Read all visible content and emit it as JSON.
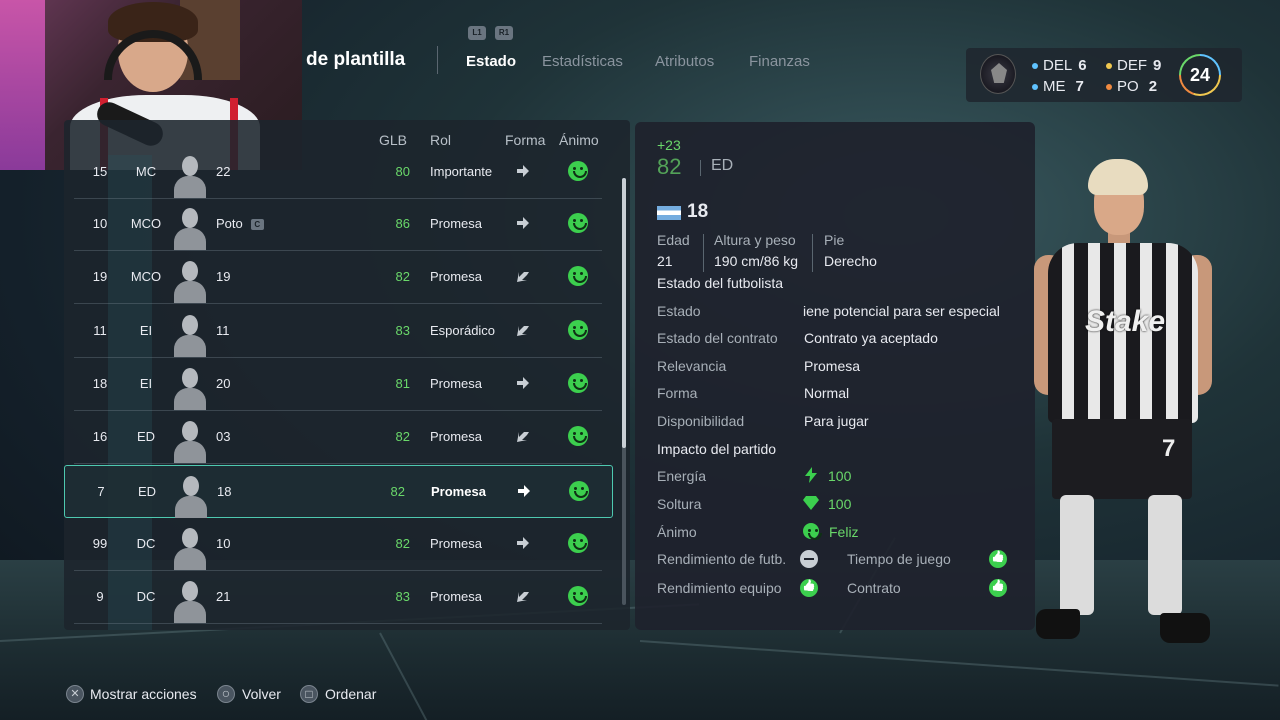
{
  "header": {
    "title": "de plantilla",
    "shoulder_left": "L1",
    "shoulder_right": "R1",
    "tabs": [
      {
        "label": "Estado",
        "active": true
      },
      {
        "label": "Estadísticas",
        "active": false
      },
      {
        "label": "Atributos",
        "active": false
      },
      {
        "label": "Finanzas",
        "active": false
      }
    ]
  },
  "team_summary": {
    "positions": [
      {
        "label": "DEL",
        "count": "6",
        "color": "#5fc3ff"
      },
      {
        "label": "DEF",
        "count": "9",
        "color": "#f0c850"
      },
      {
        "label": "ME",
        "count": "7",
        "color": "#5fc3ff"
      },
      {
        "label": "PO",
        "count": "2",
        "color": "#f08a40"
      }
    ],
    "total": "24"
  },
  "table": {
    "headers": {
      "glb": "GLB",
      "role": "Rol",
      "form": "Forma",
      "mood": "Ánimo"
    },
    "rows": [
      {
        "num": "15",
        "pos": "MC",
        "name": "22",
        "glb": "80",
        "role": "Importante",
        "form": "right"
      },
      {
        "num": "10",
        "pos": "MCO",
        "name": "Poto",
        "captain": "C",
        "glb": "86",
        "role": "Promesa",
        "form": "right"
      },
      {
        "num": "19",
        "pos": "MCO",
        "name": "19",
        "glb": "82",
        "role": "Promesa",
        "form": "down-left"
      },
      {
        "num": "11",
        "pos": "EI",
        "name": "11",
        "glb": "83",
        "role": "Esporádico",
        "form": "down-left"
      },
      {
        "num": "18",
        "pos": "EI",
        "name": "20",
        "glb": "81",
        "role": "Promesa",
        "form": "right"
      },
      {
        "num": "16",
        "pos": "ED",
        "name": "03",
        "glb": "82",
        "role": "Promesa",
        "form": "down-left"
      },
      {
        "num": "7",
        "pos": "ED",
        "name": "18",
        "glb": "82",
        "role": "Promesa",
        "form": "right",
        "selected": true
      },
      {
        "num": "99",
        "pos": "DC",
        "name": "10",
        "glb": "82",
        "role": "Promesa",
        "form": "right"
      },
      {
        "num": "9",
        "pos": "DC",
        "name": "21",
        "glb": "83",
        "role": "Promesa",
        "form": "down-left"
      }
    ]
  },
  "detail": {
    "potential_gain": "+23",
    "rating": "82",
    "position": "ED",
    "player_name": "18",
    "age_label": "Edad",
    "age": "21",
    "height_weight_label": "Altura y peso",
    "height_weight": "190 cm/86 kg",
    "foot_label": "Pie",
    "foot": "Derecho",
    "status_section": "Estado del futbolista",
    "fields": [
      {
        "label": "Estado",
        "value": "iene potencial para ser especial"
      },
      {
        "label": "Estado del contrato",
        "value": "Contrato ya aceptado"
      },
      {
        "label": "Relevancia",
        "value": "Promesa"
      },
      {
        "label": "Forma",
        "value": "Normal"
      },
      {
        "label": "Disponibilidad",
        "value": "Para jugar"
      }
    ],
    "impact_section": "Impacto del partido",
    "energy_label": "Energía",
    "energy": "100",
    "fluency_label": "Soltura",
    "fluency": "100",
    "mood_label": "Ánimo",
    "mood": "Feliz",
    "perf_label": "Rendimiento de futb.",
    "playtime_label": "Tiempo de juego",
    "team_perf_label": "Rendimiento equipo",
    "contract_label": "Contrato"
  },
  "player_render": {
    "sponsor": "Stake",
    "shorts_number": "7"
  },
  "footer": {
    "actions_label": "Mostrar acciones",
    "back_label": "Volver",
    "sort_label": "Ordenar"
  }
}
